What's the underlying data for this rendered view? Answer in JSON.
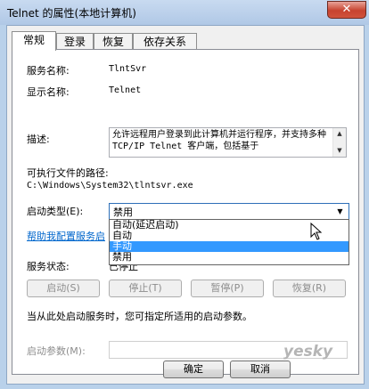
{
  "window": {
    "title": "Telnet 的属性(本地计算机)",
    "close": "✕"
  },
  "tabs": [
    "常规",
    "登录",
    "恢复",
    "依存关系"
  ],
  "general": {
    "service_name_label": "服务名称:",
    "service_name": "TlntSvr",
    "display_name_label": "显示名称:",
    "display_name": "Telnet",
    "description_label": "描述:",
    "description": "允许远程用户登录到此计算机并运行程序，并支持多种 TCP/IP Telnet 客户端，包括基于",
    "exe_path_label": "可执行文件的路径:",
    "exe_path": "C:\\Windows\\System32\\tlntsvr.exe",
    "startup_type_label": "启动类型(E):",
    "startup_type_value": "禁用",
    "startup_options": [
      "自动(延迟启动)",
      "自动",
      "手动",
      "禁用"
    ],
    "selected_option_index": 2,
    "help_link": "帮助我配置服务启",
    "status_label": "服务状态:",
    "status_value": "已停止",
    "buttons": {
      "start": "启动(S)",
      "stop": "停止(T)",
      "pause": "暂停(P)",
      "resume": "恢复(R)"
    },
    "start_hint": "当从此处启动服务时，您可指定所适用的启动参数。",
    "start_params_label": "启动参数(M):",
    "start_params_value": ""
  },
  "footer": {
    "ok": "确定",
    "cancel": "取消"
  },
  "watermark": "yesky"
}
